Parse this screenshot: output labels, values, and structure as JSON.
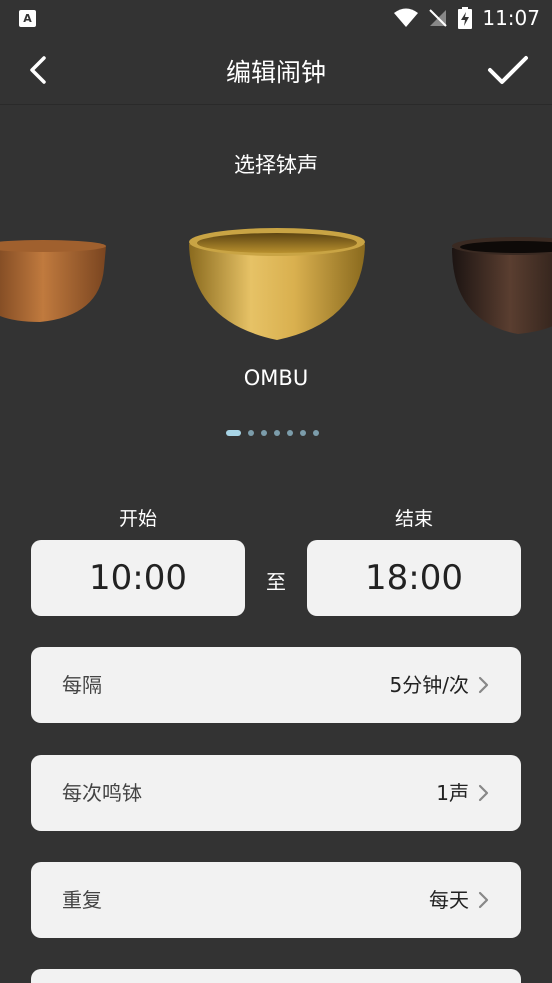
{
  "status_bar": {
    "app_icon_letter": "A",
    "time": "11:07"
  },
  "header": {
    "title": "编辑闹钟"
  },
  "bowl_picker": {
    "section_title": "选择钵声",
    "selected_name": "OMBU",
    "page_count": 7,
    "active_page": 1
  },
  "time_range": {
    "start_label": "开始",
    "start_time": "10:00",
    "to_label": "至",
    "end_label": "结束",
    "end_time": "18:00"
  },
  "settings": [
    {
      "label": "每隔",
      "value": "5分钟/次"
    },
    {
      "label": "每次鸣钵",
      "value": "1声"
    },
    {
      "label": "重复",
      "value": "每天"
    }
  ],
  "colors": {
    "background": "#333333",
    "card": "#f2f2f2",
    "dot_active": "#a8d4e6"
  }
}
